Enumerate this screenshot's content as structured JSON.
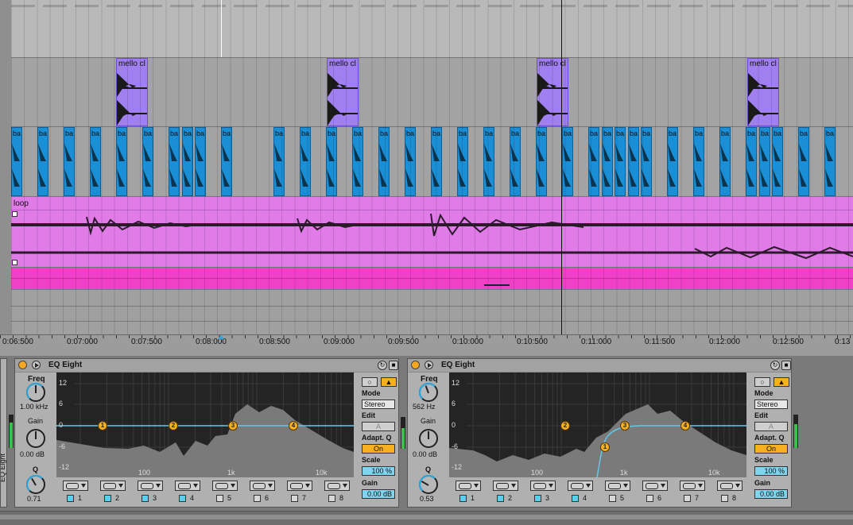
{
  "arrangement": {
    "mello_clip_label": "mello cl",
    "ba_clip_label": "ba",
    "loop_clip_label": "loop",
    "ruler_labels": [
      "0:06:500",
      "0:07:000",
      "0:07:500",
      "0:08:000",
      "0:08:500",
      "0:09:000",
      "0:09:500",
      "0:10:000",
      "0:10:500",
      "0:11:000",
      "0:11:500",
      "0:12:000",
      "0:12:500",
      "0:13"
    ]
  },
  "sidebar": {
    "label": "EQ Eight"
  },
  "devices": [
    {
      "title": "EQ Eight",
      "freq_label": "Freq",
      "freq_value": "1.00 kHz",
      "gain_label": "Gain",
      "gain_value": "0.00 dB",
      "q_label": "Q",
      "q_value": "0.71",
      "y_ticks": [
        "12",
        "6",
        "0",
        "-6",
        "-12"
      ],
      "x_ticks": [
        "100",
        "1k",
        "10k"
      ],
      "mode_label": "Mode",
      "mode_value": "Stereo",
      "edit_label": "Edit",
      "edit_value": "A",
      "adaptq_label": "Adapt. Q",
      "adaptq_value": "On",
      "scale_label": "Scale",
      "scale_value": "100 %",
      "gainout_label": "Gain",
      "gainout_value": "0.00 dB",
      "bands": [
        "1",
        "2",
        "3",
        "4",
        "5",
        "6",
        "7",
        "8"
      ],
      "band_enabled": [
        true,
        true,
        true,
        true,
        false,
        false,
        false,
        false
      ],
      "node_labels": [
        "1",
        "2",
        "3",
        "4"
      ]
    },
    {
      "title": "EQ Eight",
      "freq_label": "Freq",
      "freq_value": "562 Hz",
      "gain_label": "Gain",
      "gain_value": "0.00 dB",
      "q_label": "Q",
      "q_value": "0.53",
      "y_ticks": [
        "12",
        "6",
        "0",
        "-6",
        "-12"
      ],
      "x_ticks": [
        "100",
        "1k",
        "10k"
      ],
      "mode_label": "Mode",
      "mode_value": "Stereo",
      "edit_label": "Edit",
      "edit_value": "A",
      "adaptq_label": "Adapt. Q",
      "adaptq_value": "On",
      "scale_label": "Scale",
      "scale_value": "100 %",
      "gainout_label": "Gain",
      "gainout_value": "0.00 dB",
      "bands": [
        "1",
        "2",
        "3",
        "4",
        "5",
        "6",
        "7",
        "8"
      ],
      "band_enabled": [
        true,
        true,
        true,
        true,
        false,
        false,
        false,
        false
      ],
      "node_labels": [
        "1",
        "2",
        "3",
        "4"
      ]
    }
  ],
  "colors": {
    "mello_clip": "#a07ff0",
    "ba_clip": "#1a8fd6",
    "loop_clip": "#e07be8",
    "pink_track": "#f040c8",
    "accent_orange": "#f5a623",
    "eq_curve": "#62c8e6"
  }
}
